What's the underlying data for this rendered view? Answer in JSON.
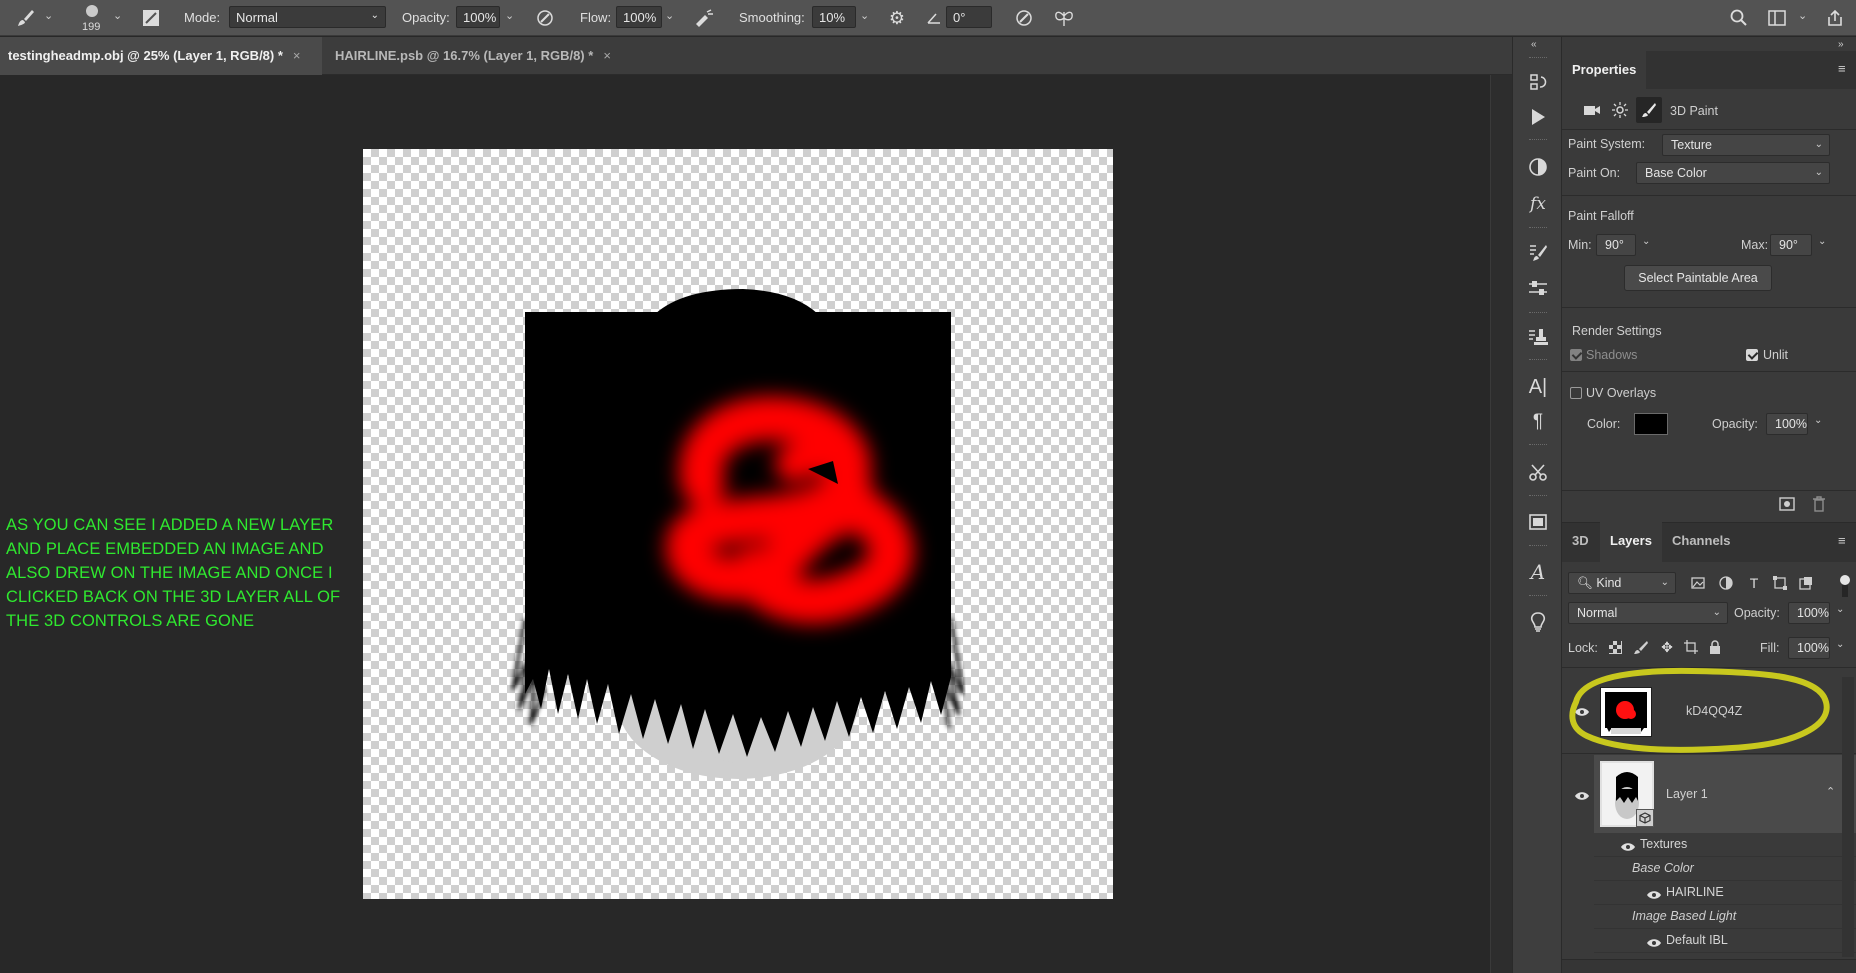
{
  "options_bar": {
    "brush_size": "199",
    "mode_label": "Mode:",
    "mode_value": "Normal",
    "opacity_label": "Opacity:",
    "opacity_value": "100%",
    "flow_label": "Flow:",
    "flow_value": "100%",
    "smoothing_label": "Smoothing:",
    "smoothing_value": "10%",
    "angle_value": "0°"
  },
  "tabs": [
    {
      "label": "testingheadmp.obj @ 25% (Layer 1, RGB/8) *",
      "close": "×",
      "active": true
    },
    {
      "label": "HAIRLINE.psb @ 16.7% (Layer 1, RGB/8) *",
      "close": "×",
      "active": false
    }
  ],
  "annotation": {
    "text": "AS YOU CAN SEE I ADDED A NEW LAYER AND PLACE EMBEDDED AN IMAGE AND ALSO DREW ON THE IMAGE AND ONCE I CLICKED BACK ON THE 3D LAYER ALL OF THE 3D CONTROLS ARE GONE",
    "color": "#2fe92f"
  },
  "properties": {
    "tab_label": "Properties",
    "mode_label": "3D Paint",
    "paint_system_label": "Paint System:",
    "paint_system_value": "Texture",
    "paint_on_label": "Paint On:",
    "paint_on_value": "Base Color",
    "falloff_label": "Paint Falloff",
    "min_label": "Min:",
    "min_value": "90°",
    "max_label": "Max:",
    "max_value": "90°",
    "select_paintable_button": "Select Paintable Area",
    "render_settings_label": "Render Settings",
    "shadows_label": "Shadows",
    "unlit_label": "Unlit",
    "uv_overlays_label": "UV Overlays",
    "color_label": "Color:",
    "overlay_color": "#000000",
    "opacity_label": "Opacity:",
    "opacity_value": "100%"
  },
  "layers_panel": {
    "tabs": [
      "3D",
      "Layers",
      "Channels"
    ],
    "active_tab": "Layers",
    "kind_label": "Kind",
    "blend_mode": "Normal",
    "opacity_label": "Opacity:",
    "opacity_value": "100%",
    "lock_label": "Lock:",
    "fill_label": "Fill:",
    "fill_value": "100%",
    "layers": [
      {
        "name": "kD4QQ4Z"
      },
      {
        "name": "Layer 1"
      }
    ],
    "sub_items": [
      {
        "label": "Textures",
        "type": "group"
      },
      {
        "label": "Base Color",
        "type": "italic"
      },
      {
        "label": "HAIRLINE",
        "type": "item"
      },
      {
        "label": "Image Based Light",
        "type": "italic"
      },
      {
        "label": "Default IBL",
        "type": "item"
      }
    ],
    "highlight_color": "#c8c81e"
  }
}
